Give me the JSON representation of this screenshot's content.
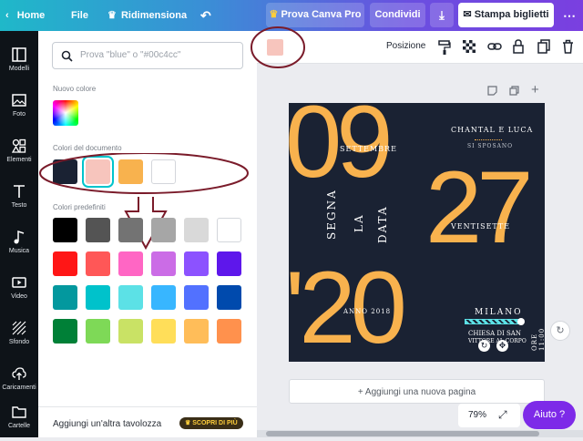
{
  "topbar": {
    "home": "Home",
    "file": "File",
    "resize": "Ridimensiona",
    "pro": "Prova Canva Pro",
    "share": "Condividi",
    "print": "Stampa biglietti"
  },
  "sidebar": {
    "items": [
      {
        "label": "Modelli",
        "icon": "templates-icon"
      },
      {
        "label": "Foto",
        "icon": "photo-icon"
      },
      {
        "label": "Elementi",
        "icon": "elements-icon"
      },
      {
        "label": "Testo",
        "icon": "text-icon"
      },
      {
        "label": "Musica",
        "icon": "music-icon"
      },
      {
        "label": "Video",
        "icon": "video-icon"
      },
      {
        "label": "Sfondo",
        "icon": "background-icon"
      },
      {
        "label": "Caricamenti",
        "icon": "upload-icon"
      },
      {
        "label": "Cartelle",
        "icon": "folder-icon"
      }
    ]
  },
  "panel": {
    "search_placeholder": "Prova \"blue\" o \"#00c4cc\"",
    "new_color_label": "Nuovo colore",
    "doc_colors_label": "Colori del documento",
    "preset_colors_label": "Colori predefiniti",
    "add_palette": "Aggiungi un'altra tavolozza",
    "discover_pro": "SCOPRI DI PIÙ",
    "doc_colors": [
      "#1a2233",
      "#f7c5bd",
      "#f8b24e",
      "#ffffff"
    ],
    "preset_colors": [
      [
        "#000000",
        "#545454",
        "#737373",
        "#a6a6a6",
        "#d9d9d9",
        "#ffffff"
      ],
      [
        "#ff1616",
        "#ff5757",
        "#ff66c4",
        "#cb6ce6",
        "#8c52ff",
        "#5e17eb"
      ],
      [
        "#03989e",
        "#00c2cb",
        "#5ce1e6",
        "#38b6ff",
        "#5271ff",
        "#004aad"
      ],
      [
        "#008037",
        "#7ed957",
        "#c9e265",
        "#ffde59",
        "#ffbd59",
        "#ff914d"
      ]
    ]
  },
  "toolbar": {
    "current_color": "#f7c5bd",
    "position": "Posizione"
  },
  "design": {
    "big_09": "09",
    "big_27": "27",
    "big_20": "'20",
    "settembre": "SETTEMBRE",
    "names": "CHANTAL E LUCA",
    "si_sposano": "SI SPOSANO",
    "segna": "SEGNA",
    "la": "LA",
    "data": "DATA",
    "ventisette": "VENTISETTE",
    "anno": "ANNO 2018",
    "milano": "MILANO",
    "chiesa": "CHIESA DI SAN",
    "vittore": "VITTORE AL CORPO",
    "ore": "ORE 11:00"
  },
  "canvas": {
    "add_page": "+ Aggiungi una nuova pagina",
    "zoom": "79%",
    "help": "Aiuto ?"
  }
}
